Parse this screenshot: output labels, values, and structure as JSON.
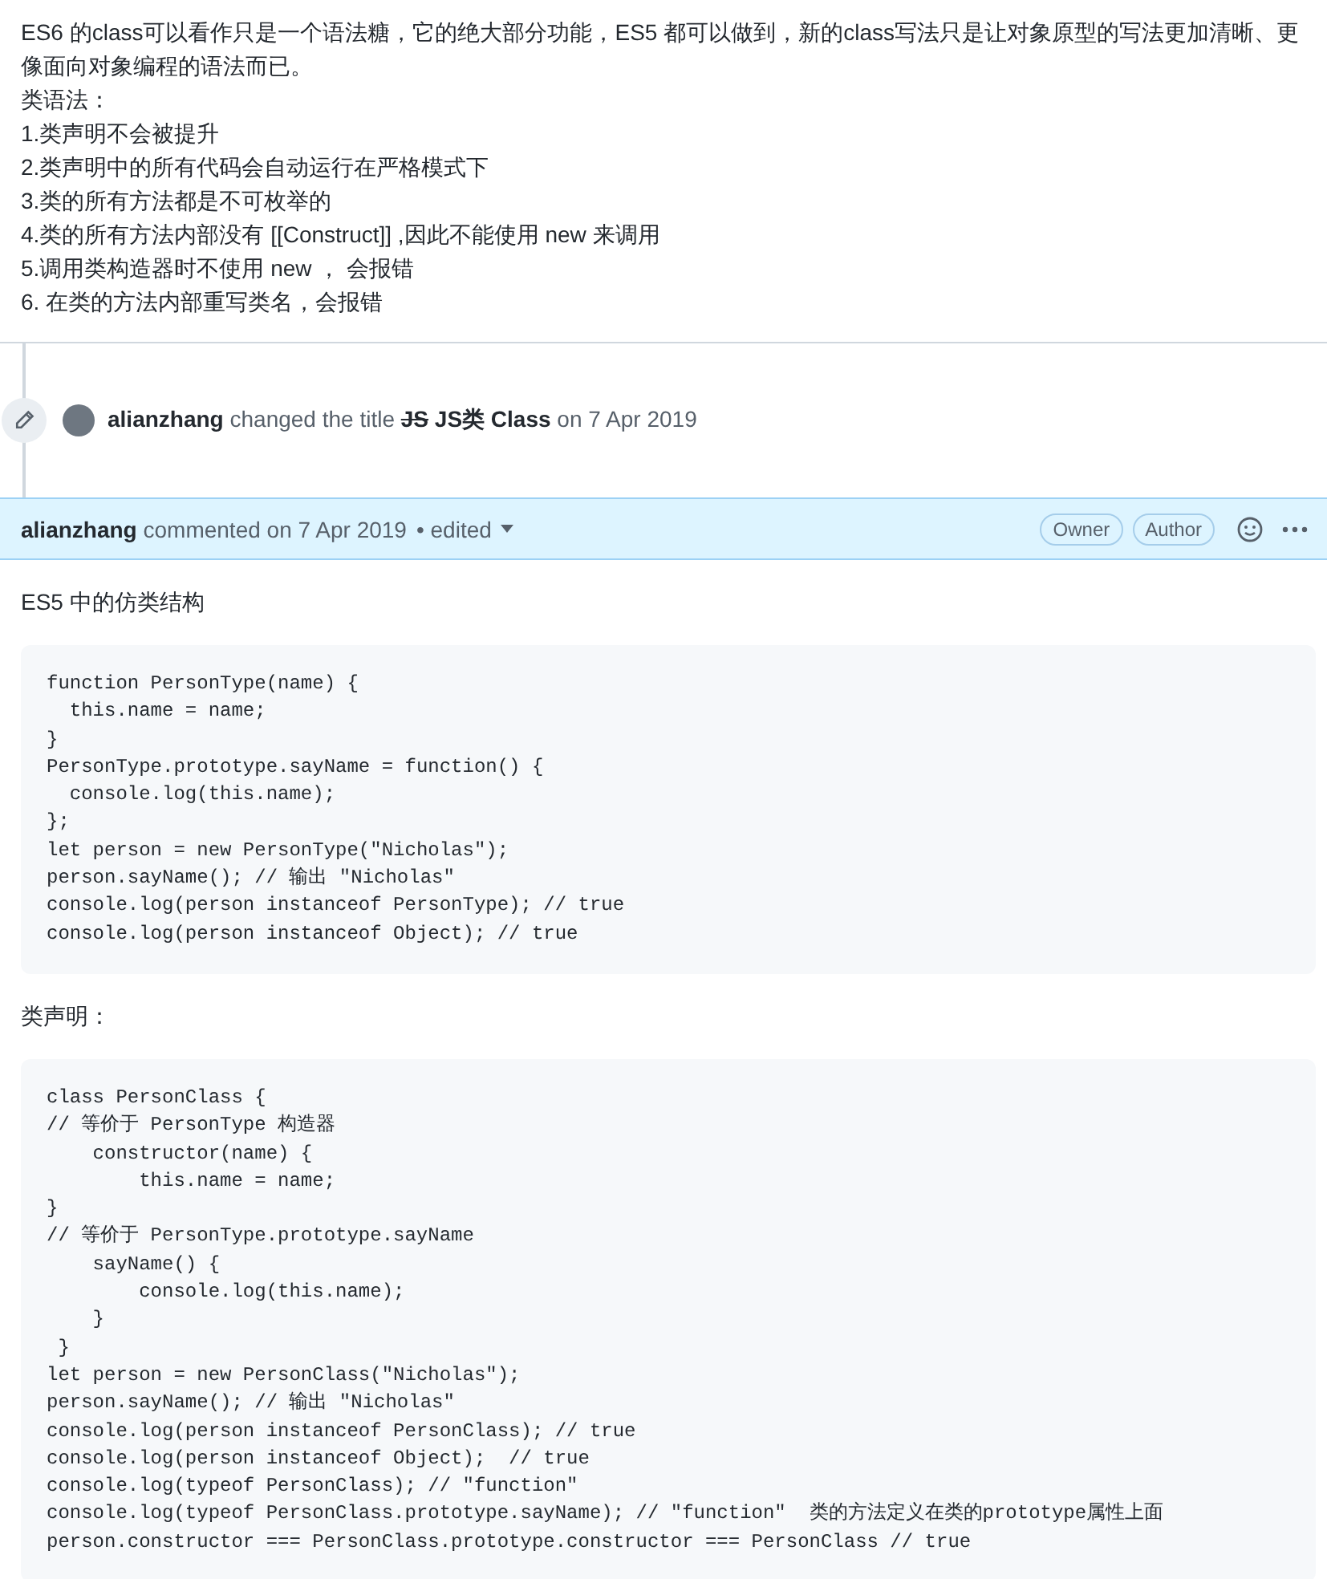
{
  "intro": {
    "paragraph": "ES6 的class可以看作只是一个语法糖，它的绝大部分功能，ES5 都可以做到，新的class写法只是让对象原型的写法更加清晰、更像面向对象编程的语法而已。",
    "heading": "类语法：",
    "items": [
      "1.类声明不会被提升",
      "2.类声明中的所有代码会自动运行在严格模式下",
      "3.类的所有方法都是不可枚举的",
      "4.类的所有方法内部没有 [[Construct]] ,因此不能使用 new 来调用",
      "5.调用类构造器时不使用 new ， 会报错",
      "6. 在类的方法内部重写类名，会报错"
    ]
  },
  "timeline_event": {
    "user": "alianzhang",
    "action": "changed the title",
    "old_title": "JS",
    "new_title": "JS类 Class",
    "date": "on 7 Apr 2019"
  },
  "comment": {
    "author": "alianzhang",
    "action": "commented on 7 Apr 2019",
    "edited": "• edited",
    "badges": [
      "Owner",
      "Author"
    ],
    "body": [
      {
        "kind": "text",
        "text": "ES5 中的仿类结构"
      },
      {
        "kind": "code",
        "lines": [
          "function PersonType(name) {",
          "  this.name = name;",
          "}",
          "PersonType.prototype.sayName = function() {",
          "  console.log(this.name);",
          "};",
          "let person = new PersonType(\"Nicholas\");",
          "person.sayName(); // 输出 \"Nicholas\"",
          "console.log(person instanceof PersonType); // true",
          "console.log(person instanceof Object); // true"
        ]
      },
      {
        "kind": "text",
        "text": "类声明："
      },
      {
        "kind": "code",
        "lines": [
          "class PersonClass {",
          "// 等价于 PersonType 构造器",
          "    constructor(name) {",
          "        this.name = name;",
          "}",
          "// 等价于 PersonType.prototype.sayName",
          "    sayName() {",
          "        console.log(this.name);",
          "    }",
          " }",
          "let person = new PersonClass(\"Nicholas\");",
          "person.sayName(); // 输出 \"Nicholas\"",
          "console.log(person instanceof PersonClass); // true",
          "console.log(person instanceof Object);  // true",
          "console.log(typeof PersonClass); // \"function\"",
          "console.log(typeof PersonClass.prototype.sayName); // \"function\"  类的方法定义在类的prototype属性上面",
          "person.constructor === PersonClass.prototype.constructor === PersonClass // true"
        ]
      }
    ]
  }
}
